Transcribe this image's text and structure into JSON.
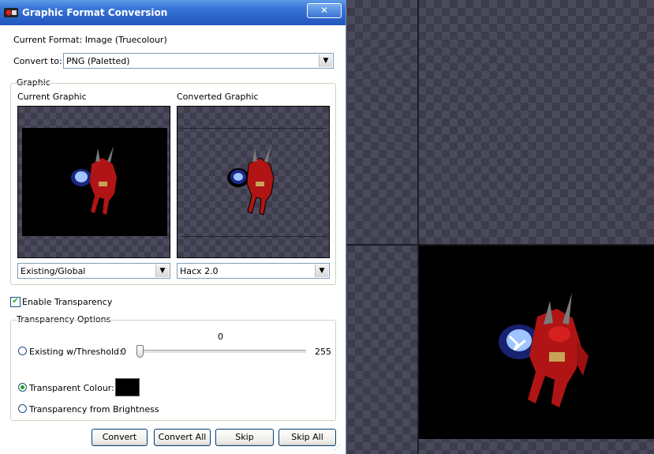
{
  "window": {
    "title": "Graphic Format Conversion",
    "close_glyph": "✕"
  },
  "format": {
    "label": "Current Format: Image (Truecolour)"
  },
  "convert_to": {
    "label": "Convert to:",
    "value": "PNG (Paletted)"
  },
  "graphic": {
    "group_label": "Graphic",
    "current_label": "Current Graphic",
    "converted_label": "Converted Graphic",
    "current_palette": "Existing/Global",
    "converted_palette": "Hacx 2.0"
  },
  "transparency": {
    "enable_label": "Enable Transparency",
    "enabled": true,
    "options_label": "Transparency Options",
    "threshold_label": "Existing w/Threshold:",
    "threshold_min": "0",
    "threshold_max": "255",
    "threshold_value": "0",
    "colour_label": "Transparent Colour:",
    "colour_value": "#000000",
    "brightness_label": "Transparency from Brightness",
    "selected": "colour"
  },
  "buttons": {
    "convert": "Convert",
    "convert_all": "Convert All",
    "skip": "Skip",
    "skip_all": "Skip All"
  },
  "icons": {
    "app": "app-icon",
    "dropdown": "chevron-down-icon",
    "check": "checkmark-icon",
    "grip": "resize-grip-icon"
  },
  "colors": {
    "title_bar": "#2a62c9",
    "selection": "#21a121",
    "transparent_colour": "#000000"
  }
}
